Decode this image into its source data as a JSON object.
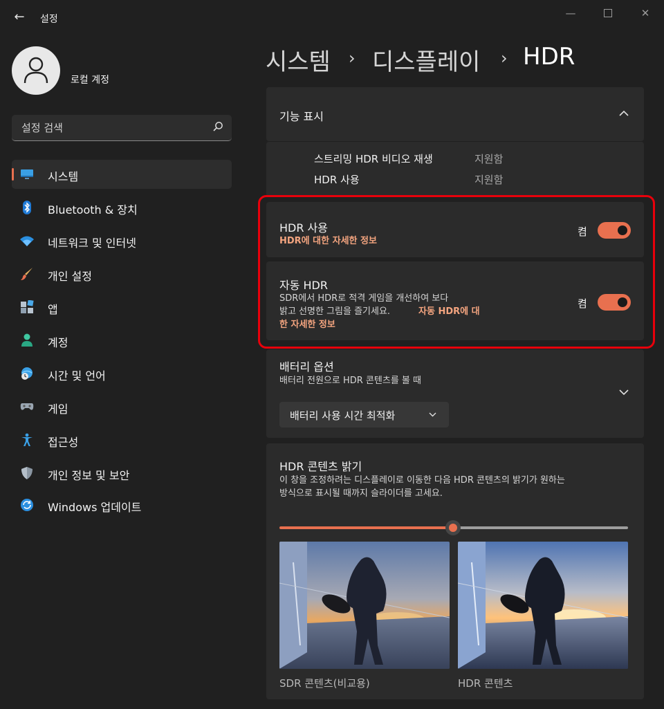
{
  "window": {
    "title": "설정"
  },
  "profile": {
    "name": "로컬 계정"
  },
  "search": {
    "placeholder": "설정 검색"
  },
  "nav": [
    {
      "label": "시스템",
      "icon": "monitor-icon",
      "active": true
    },
    {
      "label": "Bluetooth & 장치",
      "icon": "bluetooth-icon"
    },
    {
      "label": "네트워크 및 인터넷",
      "icon": "wifi-icon"
    },
    {
      "label": "개인 설정",
      "icon": "brush-icon"
    },
    {
      "label": "앱",
      "icon": "apps-icon"
    },
    {
      "label": "계정",
      "icon": "person-icon"
    },
    {
      "label": "시간 및 언어",
      "icon": "clock-globe-icon"
    },
    {
      "label": "게임",
      "icon": "gamepad-icon"
    },
    {
      "label": "접근성",
      "icon": "accessibility-icon"
    },
    {
      "label": "개인 정보 및 보안",
      "icon": "shield-icon"
    },
    {
      "label": "Windows 업데이트",
      "icon": "update-icon"
    }
  ],
  "breadcrumb": {
    "level1": "시스템",
    "level2": "디스플레이",
    "current": "HDR",
    "separator": "›"
  },
  "features": {
    "title": "기능 표시",
    "rows": [
      {
        "label": "스트리밍 HDR 비디오 재생",
        "value": "지원함"
      },
      {
        "label": "HDR 사용",
        "value": "지원함"
      }
    ]
  },
  "hdr_toggle": {
    "title": "HDR 사용",
    "link": "HDR에 대한 자세한 정보",
    "state_label": "켬",
    "on": true
  },
  "auto_hdr": {
    "title": "자동 HDR",
    "desc_line1": "SDR에서 HDR로 적격 게임을 개선하여 보다",
    "desc_line2": "밝고 선명한 그림을 즐기세요.",
    "link_part1": "자동 HDR에 대",
    "link_part2": "한 자세한 정보",
    "state_label": "켬",
    "on": true
  },
  "battery": {
    "title": "배터리 옵션",
    "subtitle": "배터리 전원으로 HDR 콘텐츠를 볼 때",
    "selected": "배터리 사용 시간 최적화"
  },
  "brightness": {
    "title": "HDR 콘텐츠 밝기",
    "desc_line1": "이 창을 조정하려는 디스플레이로 이동한 다음 HDR 콘텐츠의 밝기가 원하는",
    "desc_line2": "방식으로 표시될 때까지 슬라이더를 고세요.",
    "slider_fraction": 0.5,
    "sdr_label": "SDR 콘텐츠(비교용)",
    "hdr_label": "HDR 콘텐츠"
  },
  "colors": {
    "accent": "#e8704f",
    "link": "#f3a47f",
    "highlight_box": "#e8000b"
  }
}
